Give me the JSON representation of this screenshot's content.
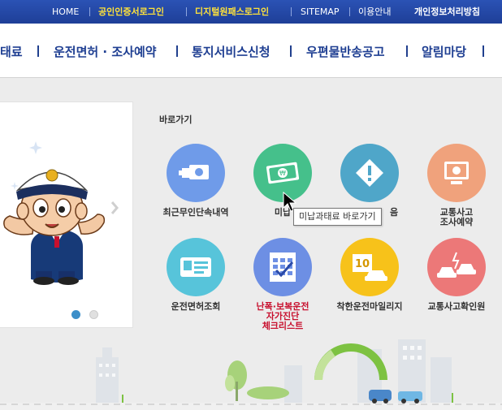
{
  "topbar": {
    "links": [
      "HOME",
      "공인인증서로그인",
      "디지털원패스로그인",
      "SITEMAP",
      "이용안내",
      "개인정보처리방침"
    ]
  },
  "nav": {
    "items": [
      "태료",
      "운전면허 · 조사예약",
      "통지서비스신청",
      "우편물반송공고",
      "알림마당"
    ]
  },
  "quick": {
    "title": "바로가기",
    "items": [
      {
        "label": "최근무인단속내역",
        "icon": "camera-icon",
        "color": "#6f9be9"
      },
      {
        "label": "미납",
        "icon": "money-icon",
        "color": "#45c08b"
      },
      {
        "label": "음",
        "icon": "warning-icon",
        "color": "#4fa6c9"
      },
      {
        "label": "교통사고\n조사예약",
        "icon": "computer-icon",
        "color": "#f0a27c"
      },
      {
        "label": "운전면허조회",
        "icon": "license-icon",
        "color": "#57c4da"
      },
      {
        "label": "난폭·보복운전\n자가진단\n체크리스트",
        "icon": "checklist-icon",
        "color": "#6d8fe4"
      },
      {
        "label": "착한운전마일리지",
        "icon": "mileage-icon",
        "color": "#f7c21a"
      },
      {
        "label": "교통사고확인원",
        "icon": "accident-icon",
        "color": "#ec7878"
      }
    ]
  },
  "tooltip": "미납과태료 바로가기",
  "colors": {
    "topbar": "#2448a8",
    "nav_text": "#1f3f92",
    "highlight": "#ffe23a",
    "alert_red": "#c8102e"
  }
}
